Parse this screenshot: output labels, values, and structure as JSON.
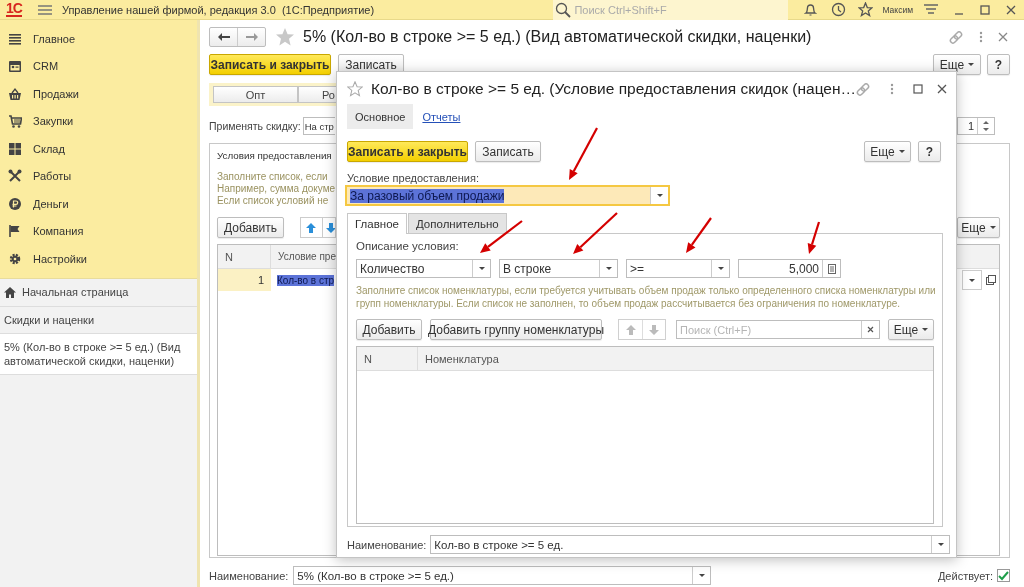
{
  "app": {
    "logo": "1С",
    "title": "Управление нашей фирмой, редакция 3.0  (1С:Предприятие)",
    "search_placeholder": "Поиск Ctrl+Shift+F",
    "user": "Максим"
  },
  "sections": [
    {
      "label": "Главное"
    },
    {
      "label": "CRM"
    },
    {
      "label": "Продажи"
    },
    {
      "label": "Закупки"
    },
    {
      "label": "Склад"
    },
    {
      "label": "Работы"
    },
    {
      "label": "Деньги"
    },
    {
      "label": "Компания"
    },
    {
      "label": "Настройки"
    }
  ],
  "history": [
    {
      "label": "Начальная страница",
      "kind": "home",
      "selected": false
    },
    {
      "label": "Скидки и наценки",
      "kind": "page",
      "selected": false
    },
    {
      "label": "5% (Кол-во в строке >= 5 ед.) (Вид автоматической скидки, наценки)",
      "kind": "page",
      "selected": true
    }
  ],
  "form": {
    "title": "5% (Кол-во в строке >= 5 ед.) (Вид автоматической скидки, наценки)",
    "save_close": "Записать и закрыть",
    "save": "Записать",
    "more": "Еще",
    "help": "?",
    "segments": [
      {
        "label": "Опт",
        "selected": false
      },
      {
        "label": "Ро",
        "selected": false
      }
    ],
    "apply_label": "Применять скидку:",
    "apply_value": "На стр",
    "spin_value": "1",
    "conditions": {
      "title": "Условия предоставления",
      "hint": [
        "Заполните список, если",
        "Например, сумма докуме",
        "Если список условий не"
      ],
      "add": "Добавить",
      "more": "Еще",
      "columns": [
        "N",
        "Условие пре"
      ],
      "rows": [
        {
          "n": "1",
          "condition": "Кол-во в стр",
          "selected": true
        }
      ]
    },
    "name_label": "Наименование:",
    "name_value": "5% (Кол-во в строке >= 5 ед.)",
    "active_label": "Действует:",
    "active": true
  },
  "dialog": {
    "title": "Кол-во в строке >= 5 ед. (Условие предоставления скидок (нацен…",
    "nav": [
      {
        "label": "Основное",
        "selected": true
      },
      {
        "label": "Отчеты",
        "selected": false
      }
    ],
    "save_close": "Записать и закрыть",
    "save": "Записать",
    "more": "Еще",
    "help": "?",
    "condition": {
      "label": "Условие предоставления:",
      "value": "За разовый объем продажи",
      "highlighted": true
    },
    "tabs": [
      {
        "label": "Главное",
        "selected": true
      },
      {
        "label": "Дополнительно",
        "selected": false
      }
    ],
    "desc_label": "Описание условия:",
    "fields": [
      {
        "kind": "select",
        "value": "Количество"
      },
      {
        "kind": "select",
        "value": "В строке"
      },
      {
        "kind": "select",
        "value": ">="
      },
      {
        "kind": "number",
        "value": "5,000"
      }
    ],
    "hint": "Заполните список номенклатуры, если требуется учитывать объем продаж только определенного списка номенклатуры или групп номенклатуры. Если список не заполнен, то объем продаж рассчитывается без ограничения по номенклатуре.",
    "add": "Добавить",
    "add_group": "Добавить группу номенклатуры",
    "search_placeholder": "Поиск (Ctrl+F)",
    "table_more": "Еще",
    "columns": [
      "N",
      "Номенклатура"
    ],
    "name_label": "Наименование:",
    "name_value": "Кол-во в строке >= 5 ед."
  }
}
